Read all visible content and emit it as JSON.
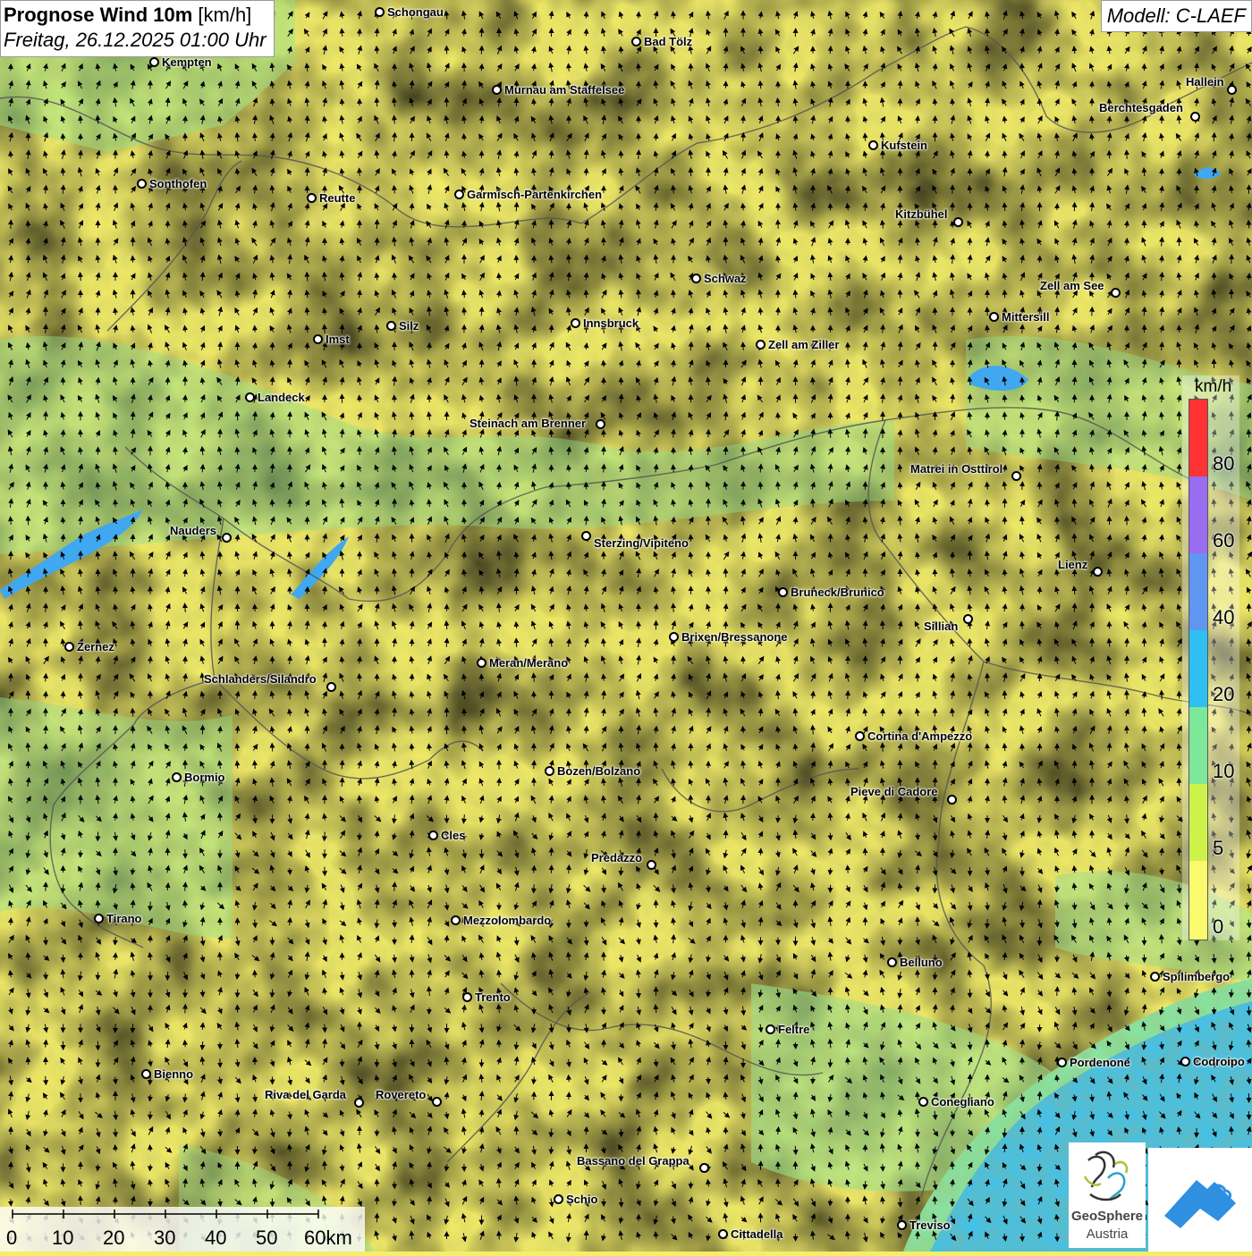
{
  "title": {
    "main_bold": "Prognose Wind 10m",
    "main_unit": " [km/h]",
    "date": "Freitag, 26.12.2025 01:00 Uhr"
  },
  "model": "Modell: C-LAEF",
  "legend": {
    "unit": "km/h",
    "ticks": [
      "80",
      "60",
      "40",
      "20",
      "10",
      "5",
      "0"
    ],
    "colors": [
      "#ff3333",
      "#9a6cf0",
      "#5f96f0",
      "#2fbff0",
      "#7ee89a",
      "#cdf24a",
      "#fafa6e"
    ]
  },
  "scale_bar": {
    "labels": [
      "0",
      "10",
      "20",
      "30",
      "40",
      "50",
      "60km"
    ]
  },
  "logos": {
    "geosphere_line1": "GeoSphere",
    "geosphere_line2": "Austria"
  },
  "icons": {
    "wind_arrow": "wind-arrow-icon",
    "city_marker": "city-marker-icon",
    "geosphere_logo": "geosphere-logo-icon",
    "hills_logo": "hills-logo-icon"
  },
  "cities": [
    {
      "name": "Schongau"
    },
    {
      "name": "Bad Tölz"
    },
    {
      "name": "Kempten"
    },
    {
      "name": "Murnau am Staffelsee"
    },
    {
      "name": "Hallein"
    },
    {
      "name": "Berchtesgaden"
    },
    {
      "name": "Kufstein"
    },
    {
      "name": "Sonthofen"
    },
    {
      "name": "Reutte"
    },
    {
      "name": "Garmisch-Partenkirchen"
    },
    {
      "name": "Kitzbühel"
    },
    {
      "name": "Schwaz"
    },
    {
      "name": "Zell am See"
    },
    {
      "name": "Mittersill"
    },
    {
      "name": "Innsbruck"
    },
    {
      "name": "Silz"
    },
    {
      "name": "Imst"
    },
    {
      "name": "Zell am Ziller"
    },
    {
      "name": "Landeck"
    },
    {
      "name": "Steinach am Brenner"
    },
    {
      "name": "Matrei in Osttirol"
    },
    {
      "name": "Nauders"
    },
    {
      "name": "Sterzing/Vipiteno"
    },
    {
      "name": "Lienz"
    },
    {
      "name": "Bruneck/Brunico"
    },
    {
      "name": "Sillian"
    },
    {
      "name": "Brixen/Bressanone"
    },
    {
      "name": "Zernez"
    },
    {
      "name": "Meran/Merano"
    },
    {
      "name": "Schlanders/Silandro"
    },
    {
      "name": "Cortina d'Ampezzo"
    },
    {
      "name": "Bormio"
    },
    {
      "name": "Bozen/Bolzano"
    },
    {
      "name": "Pieve di Cadore"
    },
    {
      "name": "Cles"
    },
    {
      "name": "Predazzo"
    },
    {
      "name": "Tirano"
    },
    {
      "name": "Mezzolombardo"
    },
    {
      "name": "Belluno"
    },
    {
      "name": "Spilimbergo"
    },
    {
      "name": "Trento"
    },
    {
      "name": "Feltre"
    },
    {
      "name": "Pordenone"
    },
    {
      "name": "Codroipo"
    },
    {
      "name": "Bienno"
    },
    {
      "name": "Riva del Garda"
    },
    {
      "name": "Rovereto"
    },
    {
      "name": "Conegliano"
    },
    {
      "name": "Bassano del Grappa"
    },
    {
      "name": "Schio"
    },
    {
      "name": "Treviso"
    },
    {
      "name": "Cittadella"
    }
  ]
}
